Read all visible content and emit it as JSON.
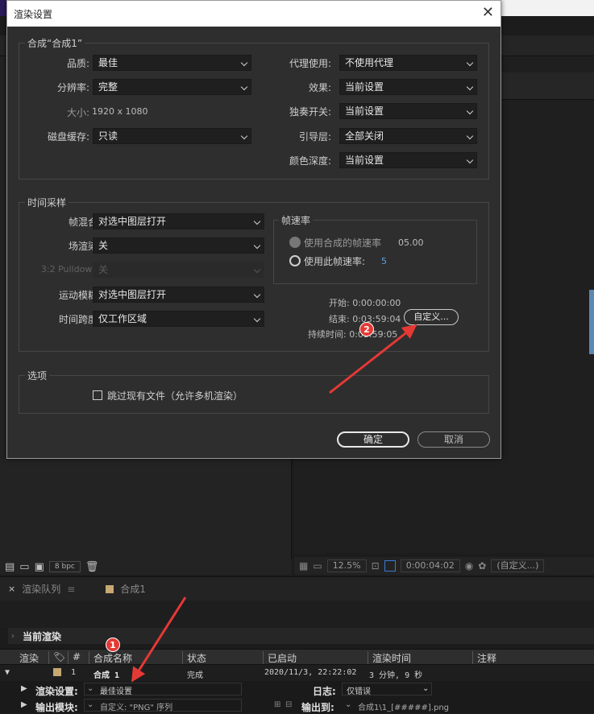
{
  "dialog": {
    "title": "渲染设置",
    "comp_group": {
      "title": "合成“合成1”",
      "quality": {
        "label": "品质:",
        "value": "最佳"
      },
      "resolution": {
        "label": "分辨率:",
        "value": "完整"
      },
      "size": {
        "label": "大小:",
        "value": "1920 x 1080"
      },
      "disk_cache": {
        "label": "磁盘缓存:",
        "value": "只读"
      },
      "proxy_use": {
        "label": "代理使用:",
        "value": "不使用代理"
      },
      "effects": {
        "label": "效果:",
        "value": "当前设置"
      },
      "solo_switches": {
        "label": "独奏开关:",
        "value": "当前设置"
      },
      "guide_layers": {
        "label": "引导层:",
        "value": "全部关闭"
      },
      "color_depth": {
        "label": "颜色深度:",
        "value": "当前设置"
      }
    },
    "time_group": {
      "title": "时间采样",
      "frame_blending": {
        "label": "帧混合:",
        "value": "对选中图层打开"
      },
      "field_render": {
        "label": "场渲染:",
        "value": "关"
      },
      "pulldown": {
        "label": "3:2 Pulldown:",
        "value": "关"
      },
      "motion_blur": {
        "label": "运动模糊:",
        "value": "对选中图层打开"
      },
      "time_span": {
        "label": "时间跨度:",
        "value": "仅工作区域"
      },
      "frame_rate": {
        "title": "帧速率",
        "use_comp_label": "使用合成的帧速率",
        "use_comp_value": "05.00",
        "use_this_label": "使用此帧速率:",
        "use_this_value": "5"
      },
      "start": "开始: 0:00:00:00",
      "end": "结束: 0:03:59:04",
      "duration": "持续时间: 0:03:59:05",
      "custom_button": "自定义..."
    },
    "options_group": {
      "title": "选项",
      "skip_existing": "跳过现有文件（允许多机渲染）"
    },
    "ok": "确定",
    "cancel": "取消"
  },
  "project_footer": {
    "bpc": "8 bpc"
  },
  "viewer_footer": {
    "zoom": "12.5%",
    "timecode": "0:00:04:02",
    "resolution": "(自定义...)"
  },
  "render_queue": {
    "tab": "渲染队列",
    "comp_tab": "合成1",
    "current_render": "当前渲染",
    "headers": {
      "render": "渲染",
      "num": "#",
      "comp_name": "合成名称",
      "status": "状态",
      "started": "已启动",
      "render_time": "渲染时间",
      "comment": "注释"
    },
    "row": {
      "num": "1",
      "comp_name": "合成 1",
      "status": "完成",
      "started": "2020/11/3, 22:22:02",
      "render_time": "3 分钟, 9 秒"
    },
    "render_settings_label": "渲染设置:",
    "render_settings_value": "最佳设置",
    "log_label": "日志:",
    "log_value": "仅错误",
    "output_module_label": "输出模块:",
    "output_module_value": "自定义: \"PNG\" 序列",
    "output_to_label": "输出到:",
    "output_to_value": "合成1\\1_[#####].png"
  },
  "annotations": {
    "badge1": "1",
    "badge2": "2"
  },
  "colors": {
    "arrow": "#e53935",
    "dialog_bg": "#2e2e2e",
    "accent": "#c7a873"
  }
}
